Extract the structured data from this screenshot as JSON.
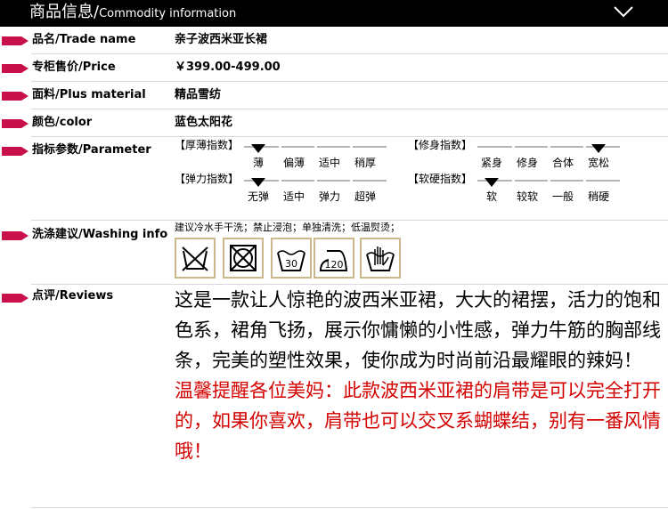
{
  "header": {
    "title_zh": "商品信息/",
    "title_en": "Commodity information"
  },
  "rows": {
    "name": {
      "label": "品名/Trade name",
      "value": "亲子波西米亚长裙"
    },
    "price": {
      "label": "专柜售价/Price",
      "value": "￥399.00-499.00"
    },
    "material": {
      "label": "面料/Plus material",
      "value": "精品雪纺"
    },
    "color": {
      "label": "颜色/color",
      "value": "蓝色太阳花"
    },
    "parameter": {
      "label": "指标参数/Parameter"
    },
    "washing": {
      "label": "洗涤建议/Washing info",
      "text": "建议冷水手干洗；禁止浸泡；单独清洗；低温熨烫；"
    },
    "reviews": {
      "label": "点评/Reviews",
      "text_black": "这是一款让人惊艳的波西米亚裙，大大的裙摆，活力的饱和色系，裙角飞扬，展示你慵懒的小性感，弹力牛筋的胸部线条，完美的塑性效果，使你成为时尚前沿最耀眼的辣妈！",
      "text_red": "温馨提醒各位美妈：此款波西米亚裙的肩带是可以完全打开的，如果你喜欢，肩带也可以交叉系蝴蝶结，别有一番风情哦！"
    }
  },
  "gauges": {
    "thickness": {
      "title": "【厚薄指数】",
      "labels": [
        "薄",
        "偏薄",
        "适中",
        "稍厚"
      ],
      "selected_index": 0
    },
    "fit": {
      "title": "【修身指数】",
      "labels": [
        "紧身",
        "修身",
        "合体",
        "宽松"
      ],
      "selected_index": 3
    },
    "elasticity": {
      "title": "【弹力指数】",
      "labels": [
        "无弹",
        "适中",
        "弹力",
        "超弹"
      ],
      "selected_index": 0
    },
    "softness": {
      "title": "【软硬指数】",
      "labels": [
        "软",
        "较软",
        "一般",
        "稍硬"
      ],
      "selected_index": 0
    }
  },
  "care_icons": [
    {
      "icon": "no-wash-icon"
    },
    {
      "icon": "no-tumble-dry-icon"
    },
    {
      "icon": "wash-30-icon",
      "number": "30"
    },
    {
      "icon": "iron-120-icon",
      "number": "120"
    },
    {
      "icon": "hand-wash-icon"
    }
  ],
  "colors": {
    "marker": "#c8104a",
    "header_bg": "#000000",
    "review_red": "#d40000",
    "icon_border": "#c9b88a"
  }
}
